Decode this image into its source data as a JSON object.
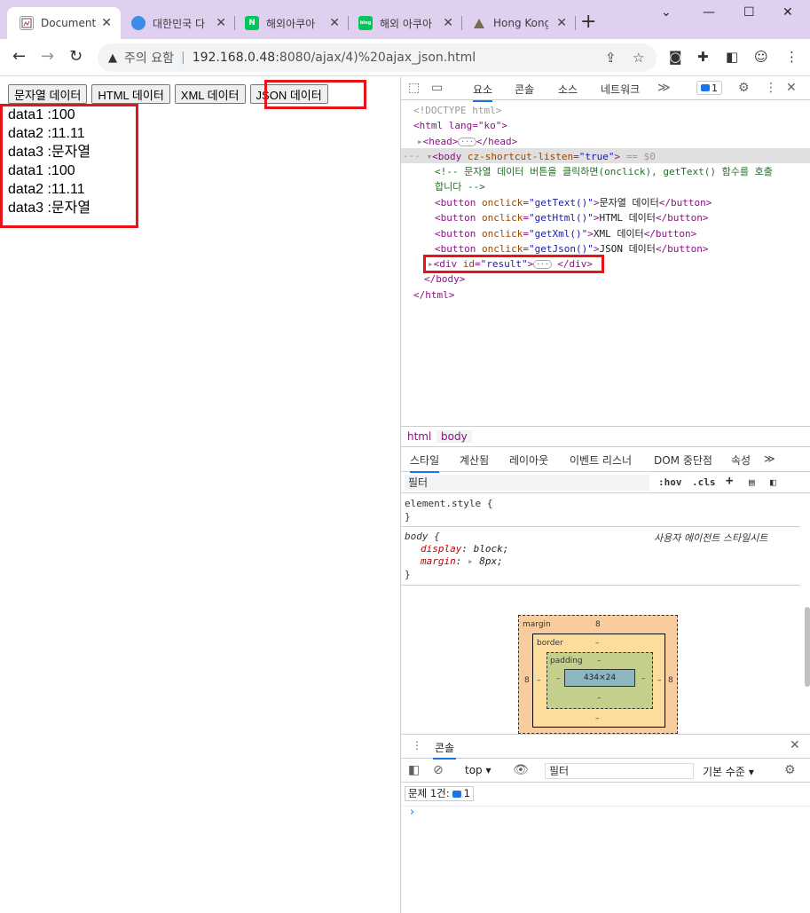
{
  "browser": {
    "tabs": [
      {
        "title": "Document",
        "favicon": "document-icon",
        "active": true
      },
      {
        "title": "대한민국 다",
        "favicon": "globe-icon"
      },
      {
        "title": "해외아쿠아",
        "favicon": "naver-icon",
        "favicon_text": "N"
      },
      {
        "title": "해외 아쿠아",
        "favicon": "blog-icon",
        "favicon_text": "blog"
      },
      {
        "title": "Hong Kong",
        "favicon": "mountain-icon"
      }
    ],
    "security_label": "주의 요함",
    "url_host": "192.168.0.48",
    "url_path": ":8080/ajax/4)%20ajax_json.html"
  },
  "page": {
    "buttons": [
      "문자열 데이터",
      "HTML 데이터",
      "XML 데이터",
      "JSON 데이터"
    ],
    "result_lines": [
      "data1 :100",
      "data2 :11.11",
      "data3 :문자열",
      "data1 :100",
      "data2 :11.11",
      "data3 :문자열"
    ]
  },
  "devtools": {
    "tabs": [
      "요소",
      "콘솔",
      "소스",
      "네트워크"
    ],
    "issue_count": "1",
    "dom": {
      "doctype": "<!DOCTYPE html>",
      "html_open": "<html lang=\"ko\">",
      "head": "<head>",
      "head_close": "</head>",
      "body_open_tag": "<body",
      "body_attr_name": "cz-shortcut-listen",
      "body_attr_value": "\"true\"",
      "selected_suffix": "== $0",
      "comment_line1": "<!-- 문자열 데이터 버튼을 클릭하면(onclick), getText() 함수를 호출",
      "comment_line2": "합니다 -->",
      "buttons": [
        {
          "onclick": "\"getText()\"",
          "text": "문자열 데이터"
        },
        {
          "onclick": "\"getHtml()\"",
          "text": "HTML 데이터"
        },
        {
          "onclick": "\"getXml()\"",
          "text": "XML 데이터"
        },
        {
          "onclick": "\"getJson()\"",
          "text": "JSON 데이터"
        }
      ],
      "div_id": "\"result\"",
      "body_close": "</body>",
      "html_close": "</html>"
    },
    "breadcrumbs": [
      "html",
      "body"
    ],
    "style_tabs": [
      "스타일",
      "계산됨",
      "레이아웃",
      "이벤트 리스너",
      "DOM 중단점",
      "속성"
    ],
    "filter_placeholder": "필터",
    "hov_label": ":hov",
    "cls_label": ".cls",
    "element_style": "element.style {",
    "body_rule": {
      "selector": "body {",
      "source": "사용자 에이전트 스타일시트",
      "decls": [
        {
          "prop": "display",
          "value": "block;"
        },
        {
          "prop": "margin",
          "value": "8px;"
        }
      ]
    },
    "box_model": {
      "margin_label": "margin",
      "margin_value": "8",
      "border_label": "border",
      "padding_label": "padding",
      "content": "434×24",
      "dash": "–",
      "side_value": "8"
    },
    "drawer": {
      "tab": "콘솔",
      "context": "top",
      "filter_placeholder": "필터",
      "level": "기본 수준",
      "issues_label": "문제 1건:",
      "issues_count": "1",
      "prompt": "›"
    }
  }
}
